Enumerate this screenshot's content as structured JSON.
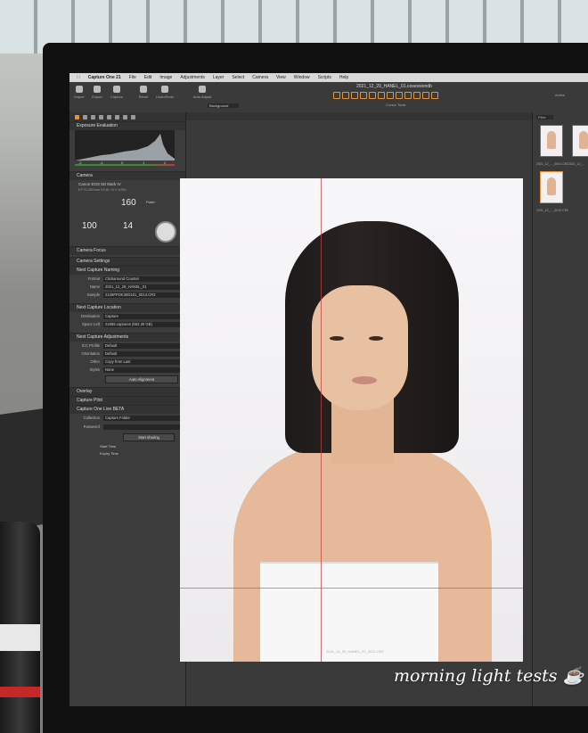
{
  "menu": [
    "Capture One 21",
    "File",
    "Edit",
    "Image",
    "Adjustments",
    "Layer",
    "Select",
    "Camera",
    "View",
    "Window",
    "Scripts",
    "Help"
  ],
  "document_title": "2021_12_29_HANEL_01.cosessiondb",
  "toolbar": {
    "import": "Import",
    "export": "Export",
    "capture": "Capture",
    "reset": "Reset",
    "undo_redo": "Undo/Redo",
    "auto_adjust": "Auto Adjust",
    "cursor_tools": "Cursor Tools",
    "background": "Background",
    "filter": "Filter"
  },
  "left_panel": {
    "exposure_evaluation": "Exposure Evaluation",
    "hist_ticks": [
      "-2",
      "-1",
      "0",
      "1",
      "2"
    ],
    "camera": "Camera",
    "camera_model": "Canon EOS 5D Mark IV",
    "camera_lens": "EF70-200mm f/2.8L IS II USM",
    "shutter": "160",
    "flash": "Flash",
    "iso": "100",
    "aperture": "14",
    "camera_focus": "Camera Focus",
    "camera_settings": "Camera Settings",
    "next_capture_naming": "Next Capture Naming",
    "format_label": "Format",
    "format_val": "Clickaround Counter",
    "name_label": "Name",
    "name_val": "2021_12_29_HANEL_01",
    "sample_label": "Sample",
    "sample_val": "2126FPOK30D101_0013.CR2",
    "next_capture_location": "Next Capture Location",
    "destination_label": "Destination",
    "destination_val": "Capture",
    "space_label": "Space Left",
    "space_val": "24355 captures (662.30 GB)",
    "next_capture_adjustments": "Next Capture Adjustments",
    "icc_label": "ICC Profile",
    "icc_val": "Default",
    "orientation_label": "Orientation",
    "orientation_val": "Default",
    "other_label": "Other",
    "other_val": "Copy from Last",
    "styles_label": "Styles",
    "styles_val": "None",
    "auto_alignment": "Auto Alignment",
    "overlay": "Overlay",
    "capture_pilot": "Capture Pilot",
    "live_beta": "Capture One Live BETA",
    "collection_label": "Collection",
    "collection_val": "Capture Folder",
    "password_label": "Password",
    "start_sharing": "Start sharing",
    "start_time_label": "Start Time",
    "expiry_time_label": "Expiry Time"
  },
  "viewer": {
    "file_caption": "2021_12_29_HANEL_01_0012.CR2"
  },
  "browser": {
    "filter": "Filter",
    "active": "Active",
    "thumbs": [
      {
        "label": "2021_12_..._0001.CR2"
      },
      {
        "label": "2021_12_..."
      },
      {
        "label": "2021_12_..._0012.CR2"
      }
    ]
  },
  "overlay_caption": "morning light tests ☕",
  "colors": {
    "accent": "#e8923a",
    "guide": "#c24040"
  }
}
